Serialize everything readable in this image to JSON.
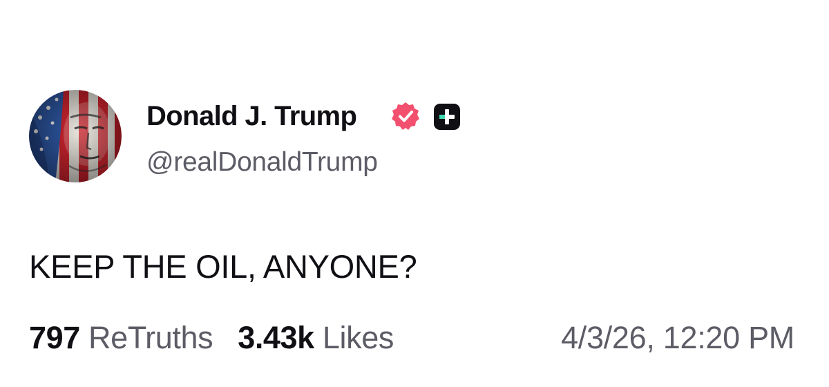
{
  "post": {
    "author": {
      "display_name": "Donald J. Trump",
      "handle": "@realDonaldTrump",
      "avatar": "american-flag-portrait",
      "verified_icon": "verified-badge-icon",
      "verified_color": "#f2506e",
      "plus_icon": "plus-badge-icon"
    },
    "text": "KEEP THE OIL, ANYONE?",
    "stats": {
      "retruths_count": "797",
      "retruths_label": "ReTruths",
      "likes_count": "3.43k",
      "likes_label": "Likes"
    },
    "timestamp": "4/3/26, 12:20 PM"
  }
}
